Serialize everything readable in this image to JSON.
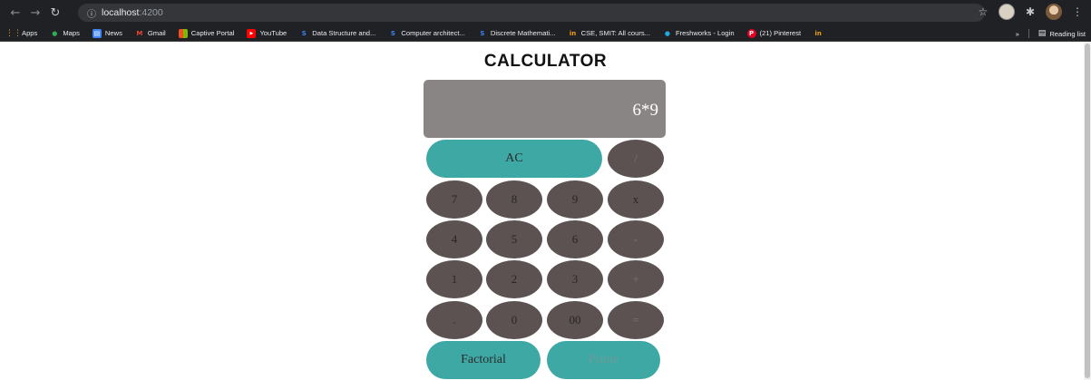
{
  "browser": {
    "url_host": "localhost",
    "url_port": ":4200",
    "bookmarks": [
      {
        "label": "Apps",
        "icon": "apps-grid-icon",
        "color": "#e8a33d"
      },
      {
        "label": "Maps",
        "icon": "maps-icon",
        "color": "#34a853"
      },
      {
        "label": "News",
        "icon": "news-icon",
        "color": "#4285f4"
      },
      {
        "label": "Gmail",
        "icon": "gmail-icon",
        "color": "#ea4335"
      },
      {
        "label": "Captive Portal",
        "icon": "windows-icon",
        "color": "#f25022"
      },
      {
        "label": "YouTube",
        "icon": "youtube-icon",
        "color": "#ff0000"
      },
      {
        "label": "Data Structure and...",
        "icon": "s-icon",
        "color": "#3b82f6"
      },
      {
        "label": "Computer architect...",
        "icon": "s-icon",
        "color": "#3b82f6"
      },
      {
        "label": "Discrete Mathemati...",
        "icon": "s-icon",
        "color": "#3b82f6"
      },
      {
        "label": "CSE, SMIT: All cours...",
        "icon": "in-icon",
        "color": "#f59e0b"
      },
      {
        "label": "Freshworks - Login",
        "icon": "freshworks-icon",
        "color": "#21a9e1"
      },
      {
        "label": "(21) Pinterest",
        "icon": "pinterest-icon",
        "color": "#e60023"
      }
    ],
    "reading_list": "Reading list",
    "overflow": "»"
  },
  "calculator": {
    "title": "CALCULATOR",
    "display_value": "6*9",
    "keys": {
      "ac": "AC",
      "divide": "/",
      "seven": "7",
      "eight": "8",
      "nine": "9",
      "multiply": "x",
      "four": "4",
      "five": "5",
      "six": "6",
      "minus": "-",
      "one": "1",
      "two": "2",
      "three": "3",
      "plus": "+",
      "dot": ".",
      "zero": "0",
      "double_zero": "00",
      "equals": "=",
      "factorial": "Factorial",
      "prime": "Prime"
    },
    "colors": {
      "display_bg": "#8a8585",
      "key_bg": "#5b5251",
      "accent": "#3ea8a5"
    }
  }
}
